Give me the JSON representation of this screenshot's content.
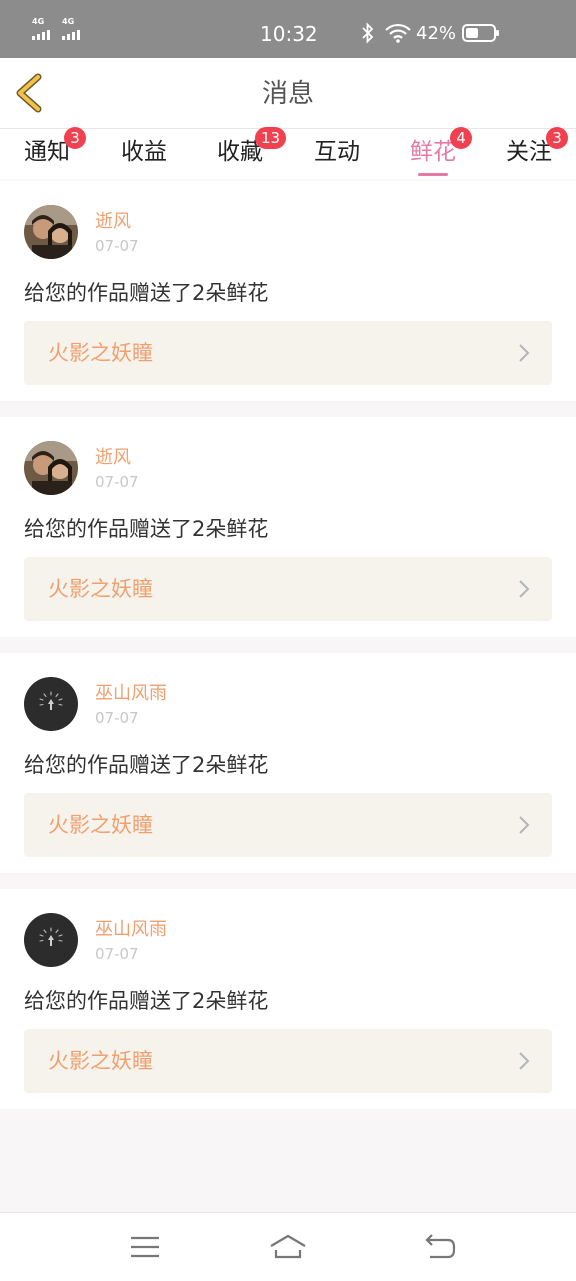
{
  "status": {
    "sim1": "4G",
    "sim2": "4G",
    "time": "10:32",
    "battery": "42%"
  },
  "header": {
    "title": "消息"
  },
  "tabs": [
    {
      "label": "通知",
      "badge": "3"
    },
    {
      "label": "收益",
      "badge": ""
    },
    {
      "label": "收藏",
      "badge": "13"
    },
    {
      "label": "互动",
      "badge": ""
    },
    {
      "label": "鲜花",
      "badge": "4",
      "active": true
    },
    {
      "label": "关注",
      "badge": "3"
    }
  ],
  "messages": [
    {
      "user": "逝风",
      "date": "07-07",
      "text": "给您的作品赠送了2朵鲜花",
      "work": "火影之妖瞳"
    },
    {
      "user": "逝风",
      "date": "07-07",
      "text": "给您的作品赠送了2朵鲜花",
      "work": "火影之妖瞳"
    },
    {
      "user": "巫山风雨",
      "date": "07-07",
      "text": "给您的作品赠送了2朵鲜花",
      "work": "火影之妖瞳"
    },
    {
      "user": "巫山风雨",
      "date": "07-07",
      "text": "给您的作品赠送了2朵鲜花",
      "work": "火影之妖瞳"
    }
  ],
  "colors": {
    "accent": "#e57aa7",
    "badge": "#f1404f",
    "name": "#f0a070",
    "back_arrow": "#f0c24a"
  },
  "icons": {
    "back": "back-arrow-icon",
    "chevron": "chevron-right-icon",
    "nav_menu": "menu-icon",
    "nav_home": "home-icon",
    "nav_back": "return-icon"
  }
}
